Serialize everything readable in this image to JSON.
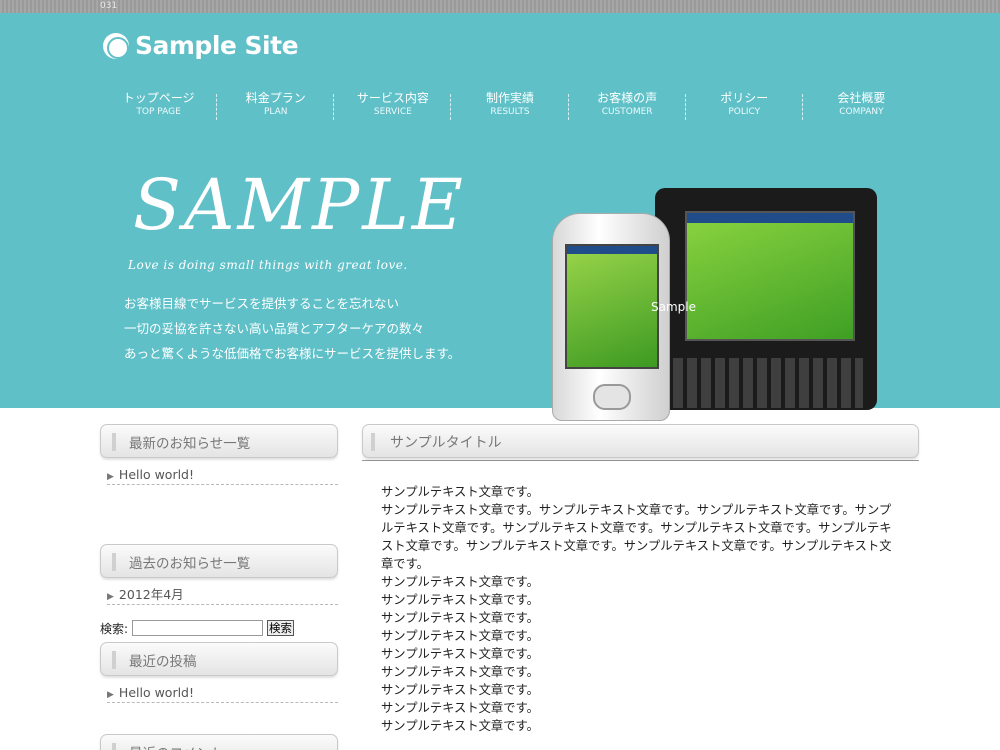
{
  "top_strip": {
    "text": "031"
  },
  "logo": {
    "text": "Sample Site"
  },
  "nav": [
    {
      "jp": "トップページ",
      "en": "TOP PAGE"
    },
    {
      "jp": "料金プラン",
      "en": "PLAN"
    },
    {
      "jp": "サービス内容",
      "en": "SERVICE"
    },
    {
      "jp": "制作実績",
      "en": "RESULTS"
    },
    {
      "jp": "お客様の声",
      "en": "CUSTOMER"
    },
    {
      "jp": "ポリシー",
      "en": "POLICY"
    },
    {
      "jp": "会社概要",
      "en": "COMPANY"
    }
  ],
  "hero": {
    "title": "SAMPLE",
    "tagline": "Love is doing small things with great love.",
    "lines": [
      "お客様目線でサービスを提供することを忘れない",
      "一切の妥協を許さない高い品質とアフターケアの数々",
      "あっと驚くような低価格でお客様にサービスを提供します。"
    ],
    "image_caption": "Sample"
  },
  "sidebar": {
    "latest_news": {
      "title": "最新のお知らせ一覧",
      "items": [
        "Hello world!"
      ]
    },
    "past_news": {
      "title": "過去のお知らせ一覧",
      "items": [
        "2012年4月"
      ]
    },
    "search": {
      "label": "検索:",
      "button": "検索",
      "value": ""
    },
    "recent_posts": {
      "title": "最近の投稿",
      "items": [
        "Hello world!"
      ]
    },
    "recent_comments": {
      "title": "最近のコメント"
    }
  },
  "main": {
    "title": "サンプルタイトル",
    "paragraphs": [
      "サンプルテキスト文章です。",
      "サンプルテキスト文章です。サンプルテキスト文章です。サンプルテキスト文章です。サンプルテキスト文章です。サンプルテキスト文章です。サンプルテキスト文章です。サンプルテキスト文章です。サンプルテキスト文章です。サンプルテキスト文章です。サンプルテキスト文章です。",
      "サンプルテキスト文章です。",
      "サンプルテキスト文章です。",
      "サンプルテキスト文章です。",
      "サンプルテキスト文章です。",
      "サンプルテキスト文章です。",
      "サンプルテキスト文章です。",
      "サンプルテキスト文章です。",
      "サンプルテキスト文章です。",
      "サンプルテキスト文章です。"
    ]
  },
  "colors": {
    "header_bg": "#5fc0c8",
    "top_strip": "#9a9a9a",
    "text": "#333333"
  }
}
